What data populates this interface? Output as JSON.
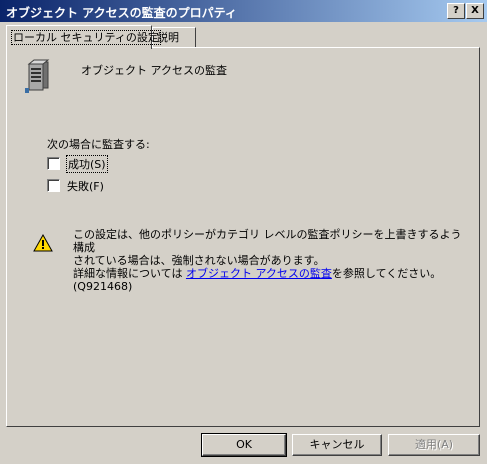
{
  "window": {
    "title": "オブジェクト アクセスの監査のプロパティ",
    "help_button": "?",
    "close_button": "X"
  },
  "tabs": [
    {
      "label": "ローカル セキュリティの設定",
      "active": true
    },
    {
      "label": "説明",
      "active": false
    }
  ],
  "policy": {
    "name": "オブジェクト アクセスの監査"
  },
  "audit": {
    "label": "次の場合に監査する:",
    "options": [
      {
        "label": "成功(S)",
        "checked": false
      },
      {
        "label": "失敗(F)",
        "checked": false
      }
    ]
  },
  "warning": {
    "line1": "この設定は、他のポリシーがカテゴリ レベルの監査ポリシーを上書きするよう構成",
    "line2": "されている場合は、強制されない場合があります。",
    "line3_prefix": "詳細な情報については ",
    "line3_link": "オブジェクト アクセスの監査",
    "line3_suffix": "を参照してください。",
    "line4": "(Q921468)"
  },
  "buttons": {
    "ok": "OK",
    "cancel": "キャンセル",
    "apply": "適用(A)"
  },
  "colors": {
    "titlebar_start": "#0a246a",
    "titlebar_end": "#a6caf0",
    "dialog_bg": "#d4d0c8",
    "link": "#0000ee"
  }
}
